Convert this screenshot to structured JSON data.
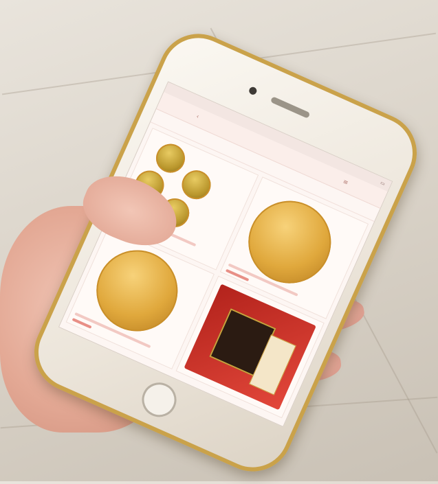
{
  "scene": {
    "description_icons": [
      "hand",
      "smartphone",
      "gold-coin"
    ],
    "colors": {
      "floor": "#e2dcd2",
      "phone_frame": "#caa24a",
      "screen_background": "#fdf6f3",
      "coin_gold": "#e0a83c",
      "product_box_red": "#b3231c"
    }
  },
  "screen": {
    "status_time": "",
    "nav_title": "",
    "tabs": []
  }
}
